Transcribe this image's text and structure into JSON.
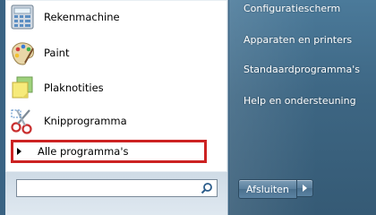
{
  "programs": [
    {
      "label": "Rekenmachine",
      "icon": "calculator-icon"
    },
    {
      "label": "Paint",
      "icon": "paint-palette-icon"
    },
    {
      "label": "Plaknotities",
      "icon": "sticky-notes-icon"
    },
    {
      "label": "Knipprogramma",
      "icon": "snipping-tool-icon"
    }
  ],
  "all_programs": {
    "label": "Alle programma's"
  },
  "search": {
    "placeholder": ""
  },
  "right_items": [
    {
      "label": "Configuratiescherm"
    },
    {
      "label": "Apparaten en printers"
    },
    {
      "label": "Standaardprogramma's"
    },
    {
      "label": "Help en ondersteuning"
    }
  ],
  "shutdown": {
    "label": "Afsluiten"
  },
  "colors": {
    "highlight_border": "#cc2222",
    "right_pane": "#3d6683"
  }
}
